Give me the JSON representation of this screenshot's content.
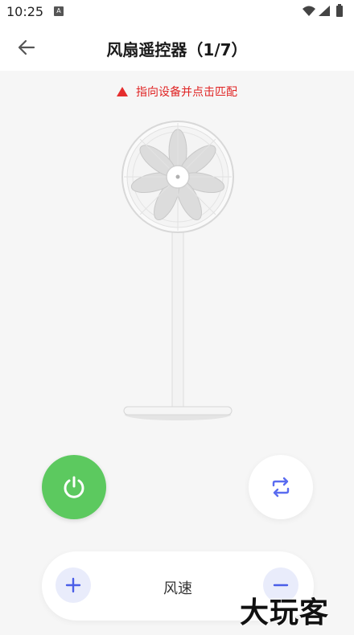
{
  "status_bar": {
    "time": "10:25",
    "a_badge": "A",
    "icons": [
      "wifi-icon",
      "signal-icon",
      "battery-icon"
    ]
  },
  "header": {
    "back_icon": "arrow-left-icon",
    "title": "风扇遥控器（1/7）"
  },
  "warning": {
    "icon": "warning-triangle-icon",
    "text": "指向设备并点击匹配",
    "color": "#e02424"
  },
  "fan_image": "standing-fan-image",
  "controls": {
    "power_icon": "power-icon",
    "power_color": "#5cc95f",
    "swing_icon": "swing-repeat-icon",
    "accent_color": "#5a6cf0",
    "speed": {
      "label": "风速",
      "plus_icon": "plus-icon",
      "minus_icon": "minus-icon"
    }
  },
  "watermark": "大玩客"
}
